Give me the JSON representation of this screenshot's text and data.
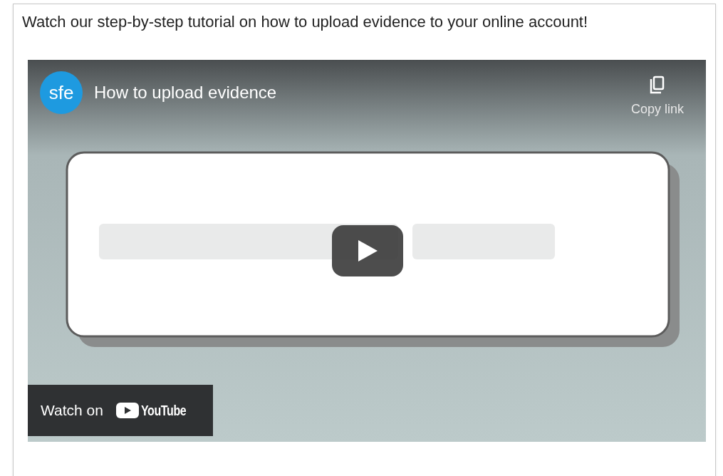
{
  "intro": "Watch our step-by-step tutorial on how to upload evidence to your online account!",
  "video": {
    "channel_avatar": "sfe",
    "title": "How to upload evidence",
    "copy_link": "Copy link",
    "watch_on": "Watch on",
    "youtube": "YouTube"
  }
}
